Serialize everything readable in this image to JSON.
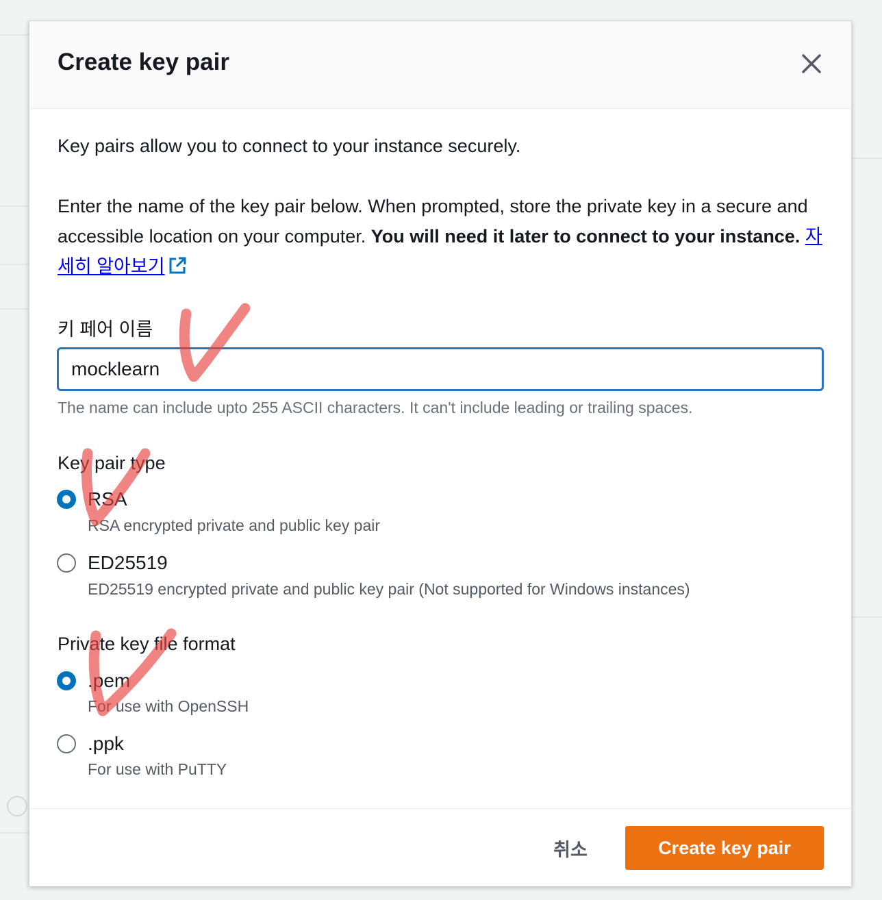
{
  "dialog": {
    "title": "Create key pair",
    "intro": "Key pairs allow you to connect to your instance securely.",
    "description": "Enter the name of the key pair below. When prompted, store the private key in a secure and accessible location on your computer. ",
    "description_bold": "You will need it later to connect to your instance.",
    "learn_more_link": "자세히 알아보기"
  },
  "key_name": {
    "label": "키 페어 이름",
    "value": "mocklearn",
    "hint": "The name can include upto 255 ASCII characters. It can't include leading or trailing spaces."
  },
  "key_pair_type": {
    "title": "Key pair type",
    "selected": "RSA",
    "options": [
      {
        "label": "RSA",
        "description": "RSA encrypted private and public key pair"
      },
      {
        "label": "ED25519",
        "description": "ED25519 encrypted private and public key pair (Not supported for Windows instances)"
      }
    ]
  },
  "file_format": {
    "title": "Private key file format",
    "selected": ".pem",
    "options": [
      {
        "label": ".pem",
        "description": "For use with OpenSSH"
      },
      {
        "label": ".ppk",
        "description": "For use with PuTTY"
      }
    ]
  },
  "footer": {
    "cancel_label": "취소",
    "create_label": "Create key pair"
  },
  "colors": {
    "primary_button": "#ec7211",
    "selected_radio": "#0073bb",
    "input_focus_border": "#2e73b8",
    "annotation_checkmark": "#e8423f"
  },
  "icons": {
    "close": "close-icon",
    "external_link": "external-link-icon",
    "annotation": "checkmark-annotation-icon"
  }
}
